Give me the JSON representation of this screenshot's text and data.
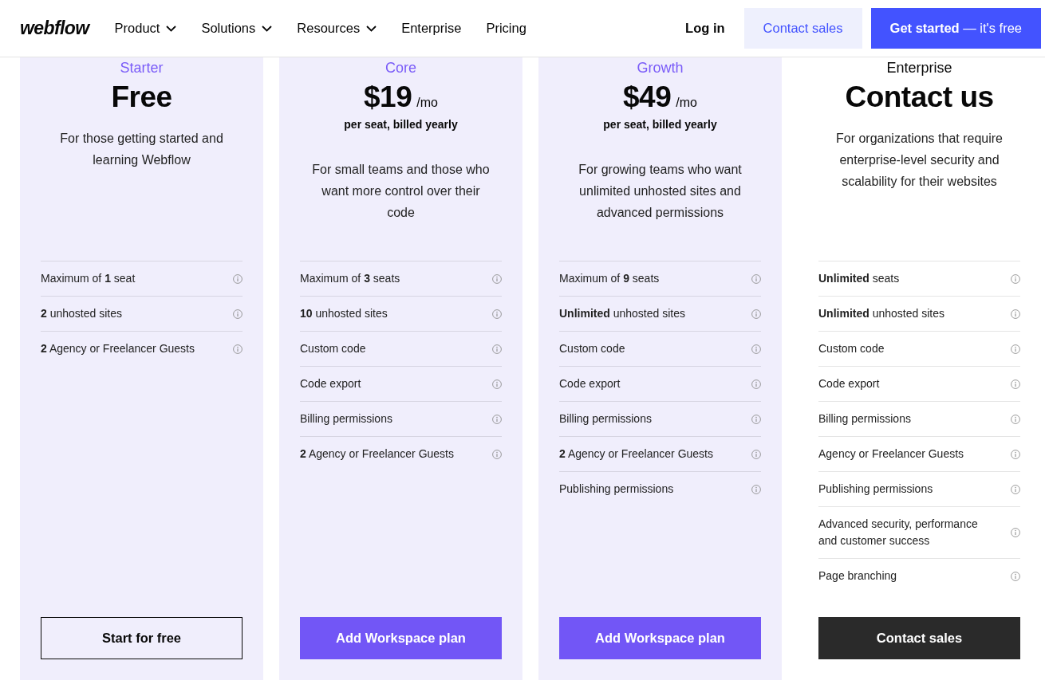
{
  "nav": {
    "logo": "webflow",
    "links": [
      {
        "label": "Product",
        "dropdown": true
      },
      {
        "label": "Solutions",
        "dropdown": true
      },
      {
        "label": "Resources",
        "dropdown": true
      },
      {
        "label": "Enterprise",
        "dropdown": false
      },
      {
        "label": "Pricing",
        "dropdown": false
      }
    ],
    "login": "Log in",
    "buttons": [
      {
        "label": "Contact sales",
        "kind": "light"
      },
      {
        "label": "**Get started** — it's free",
        "kind": "primary"
      }
    ]
  },
  "plans": [
    {
      "name": "Starter",
      "tinted": true,
      "price": {
        "amount": "Free"
      },
      "description": "For those getting started and learning Webflow",
      "features": [
        "Maximum of **1** seat",
        "**2** unhosted sites",
        "**2** Agency or Freelancer Guests"
      ],
      "button": {
        "label": "Start for free",
        "kind": "outline"
      }
    },
    {
      "name": "Core",
      "tinted": true,
      "price": {
        "amount": "$19",
        "period": "/mo",
        "note": "per seat, billed yearly"
      },
      "description": "For small teams and those who want more control over their code",
      "features": [
        "Maximum of **3** seats",
        "**10** unhosted sites",
        "Custom code",
        "Code export",
        "Billing permissions",
        "**2** Agency or Freelancer Guests"
      ],
      "button": {
        "label": "Add Workspace plan",
        "kind": "primary"
      }
    },
    {
      "name": "Growth",
      "tinted": true,
      "price": {
        "amount": "$49",
        "period": "/mo",
        "note": "per seat, billed yearly"
      },
      "description": "For growing teams who want unlimited unhosted sites and advanced permissions",
      "features": [
        "Maximum of **9** seats",
        "**Unlimited** unhosted sites",
        "Custom code",
        "Code export",
        "Billing permissions",
        "**2** Agency or Freelancer Guests",
        "Publishing permissions"
      ],
      "button": {
        "label": "Add Workspace plan",
        "kind": "primary"
      }
    },
    {
      "name": "Enterprise",
      "tinted": false,
      "price": {
        "amount": "Contact us"
      },
      "description": "For organizations that require enterprise-level security and scalability for their websites",
      "features": [
        "**Unlimited** seats",
        "**Unlimited** unhosted sites",
        "Custom code",
        "Code export",
        "Billing permissions",
        "Agency or Freelancer Guests",
        "Publishing permissions",
        "Advanced security, performance and customer success",
        "Page branching"
      ],
      "button": {
        "label": "Contact sales",
        "kind": "dark"
      }
    }
  ]
}
